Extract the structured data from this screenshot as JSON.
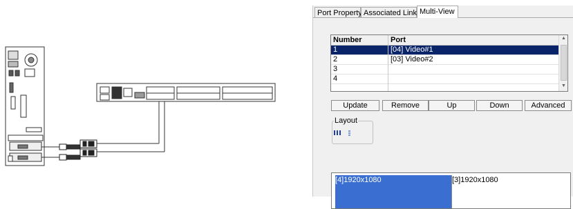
{
  "tabs": [
    {
      "label": "Port Property",
      "active": false
    },
    {
      "label": "Associated Link",
      "active": false
    },
    {
      "label": "Multi-View",
      "active": true
    }
  ],
  "grid": {
    "columns": [
      "Number",
      "Port"
    ],
    "rows": [
      {
        "number": "1",
        "port": "[04] Video#1",
        "selected": true
      },
      {
        "number": "2",
        "port": "[03] Video#2",
        "selected": false
      },
      {
        "number": "3",
        "port": "",
        "selected": false
      },
      {
        "number": "4",
        "port": "",
        "selected": false
      }
    ]
  },
  "buttons": {
    "update": "Update",
    "remove": "Remove",
    "up": "Up",
    "down": "Down",
    "advanced": "Advanced"
  },
  "layout_group": {
    "label": "Layout",
    "icons": [
      "layout-quad-icon",
      "layout-dual-icon"
    ]
  },
  "preview": {
    "primary": "[4]1920x1080",
    "secondary": "[3]1920x1080"
  },
  "colors": {
    "selection": "#0a246a",
    "preview_primary": "#3a6fd1"
  }
}
